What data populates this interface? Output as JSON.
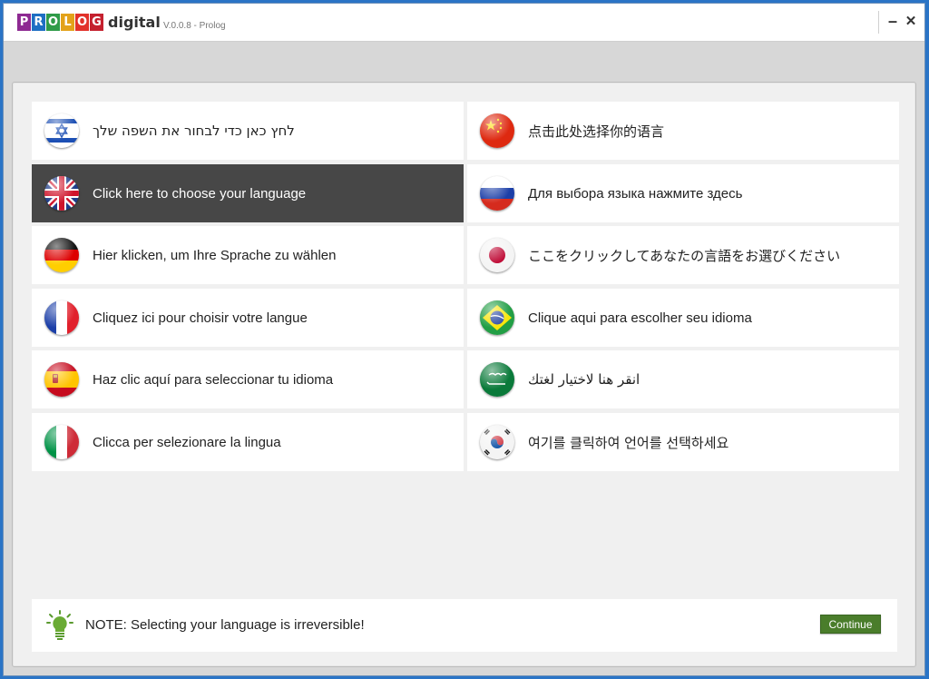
{
  "app": {
    "logo_letters": [
      "P",
      "R",
      "O",
      "L",
      "O",
      "G"
    ],
    "logo_colors": [
      "#8e2a92",
      "#1e6fc3",
      "#2f9b48",
      "#e3a21a",
      "#e2312a",
      "#c5212f"
    ],
    "logo_word": "digital",
    "version": "V.0.0.8 - Prolog",
    "minimize_glyph": "–",
    "close_glyph": "✕"
  },
  "languages": [
    {
      "id": "hebrew",
      "label": "לחץ כאן כדי לבחור את השפה שלך",
      "flag_icon": "israel-flag-icon",
      "selected": false
    },
    {
      "id": "chinese",
      "label": "点击此处选择你的语言",
      "flag_icon": "china-flag-icon",
      "selected": false
    },
    {
      "id": "english",
      "label": "Click here to choose your language",
      "flag_icon": "uk-flag-icon",
      "selected": true
    },
    {
      "id": "russian",
      "label": "Для выбора языка нажмите здесь",
      "flag_icon": "russia-flag-icon",
      "selected": false
    },
    {
      "id": "german",
      "label": "Hier klicken, um Ihre Sprache zu wählen",
      "flag_icon": "germany-flag-icon",
      "selected": false
    },
    {
      "id": "japanese",
      "label": "ここをクリックしてあなたの言語をお選びください",
      "flag_icon": "japan-flag-icon",
      "selected": false
    },
    {
      "id": "french",
      "label": "Cliquez ici pour choisir votre langue",
      "flag_icon": "france-flag-icon",
      "selected": false
    },
    {
      "id": "portuguese",
      "label": "Clique aqui para escolher seu idioma",
      "flag_icon": "brazil-flag-icon",
      "selected": false
    },
    {
      "id": "spanish",
      "label": "Haz clic aquí para seleccionar tu idioma",
      "flag_icon": "spain-flag-icon",
      "selected": false
    },
    {
      "id": "arabic",
      "label": "انقر هنا لاختيار لغتك",
      "flag_icon": "saudi-flag-icon",
      "selected": false
    },
    {
      "id": "italian",
      "label": "Clicca per selezionare la lingua",
      "flag_icon": "italy-flag-icon",
      "selected": false
    },
    {
      "id": "korean",
      "label": "여기를 클릭하여 언어를 선택하세요",
      "flag_icon": "korea-flag-icon",
      "selected": false
    }
  ],
  "note": {
    "text": "NOTE: Selecting your language is irreversible!",
    "icon": "lightbulb-icon",
    "icon_color": "#5a9a2f"
  },
  "continue_button": {
    "label": "Continue",
    "color": "#4a7d2b"
  },
  "colors": {
    "selected_row": "#474747",
    "panel_bg": "#f0f0f0",
    "window_bg": "#d7d7d7"
  }
}
